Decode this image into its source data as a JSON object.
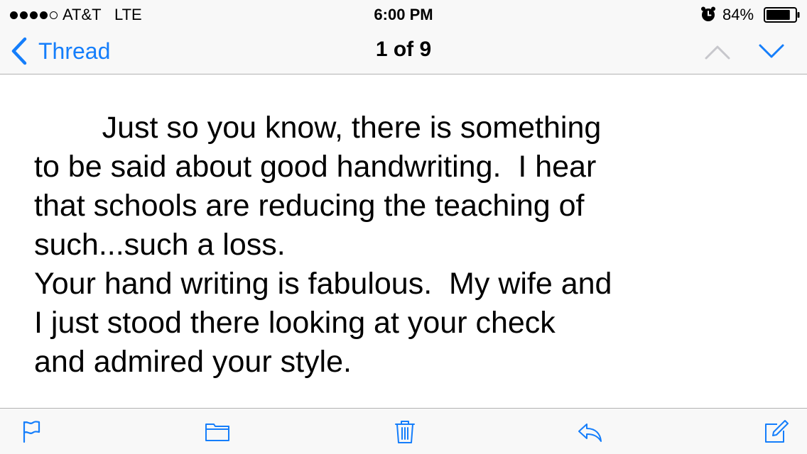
{
  "status_bar": {
    "signal_bars_filled": 4,
    "signal_bars_total": 5,
    "carrier": "AT&T",
    "network": "LTE",
    "time": "6:00 PM",
    "battery_percent": "84%",
    "battery_level": 0.84
  },
  "nav_bar": {
    "back_label": "Thread",
    "title": "1 of 9"
  },
  "message": {
    "lines": [
      "        Just so you know, there is something",
      "to be said about good handwriting.  I hear",
      "that schools are reducing the teaching of",
      "such...such a loss.",
      "Your hand writing is fabulous.  My wife and",
      "I just stood there looking at your check",
      "and admired your style."
    ]
  },
  "toolbar": {
    "icons": [
      "flag-icon",
      "folder-icon",
      "trash-icon",
      "reply-icon",
      "compose-icon"
    ]
  },
  "colors": {
    "accent": "#157efb",
    "bar_background": "#f8f8f8",
    "separator": "#b2b2b2",
    "disabled": "#c7c7cc"
  }
}
